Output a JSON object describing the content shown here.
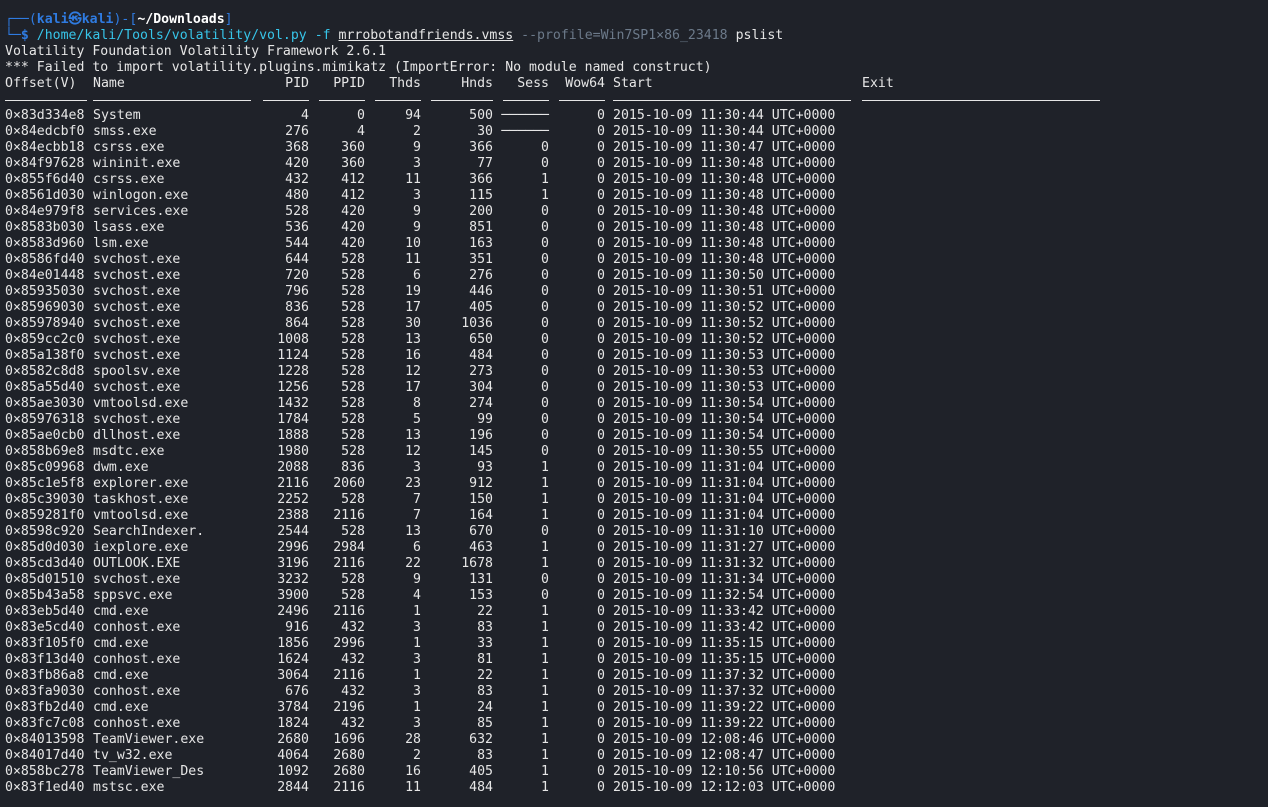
{
  "prompt": {
    "corner_top": "┌──(",
    "user": "kali",
    "at": "㉿",
    "host": "kali",
    "mid": ")-[",
    "cwd": "~/Downloads",
    "end": "]",
    "corner_bottom": "└─",
    "dollar": "$",
    "cmd_path": "/home/kali/Tools/volatility/vol.py",
    "flag_f": "-f",
    "file": "mrrobotandfriends.vmss",
    "profile": "--profile=Win7SP1×86_23418",
    "plugin": "pslist"
  },
  "output": {
    "banner": "Volatility Foundation Volatility Framework 2.6.1",
    "error": "*** Failed to import volatility.plugins.mimikatz (ImportError: No module named construct)"
  },
  "table": {
    "headers": {
      "offset": "Offset(V)",
      "name": "Name",
      "pid": "PID",
      "ppid": "PPID",
      "thds": "Thds",
      "hnds": "Hnds",
      "sess": "Sess",
      "wow64": "Wow64",
      "start": "Start",
      "exit": "Exit"
    },
    "rows": [
      {
        "offset": "0×83d334e8",
        "name": "System",
        "pid": "4",
        "ppid": "0",
        "thds": "94",
        "hnds": "500",
        "sess": "──────",
        "wow64": "0",
        "start": "2015-10-09 11:30:44 UTC+0000"
      },
      {
        "offset": "0×84edcbf0",
        "name": "smss.exe",
        "pid": "276",
        "ppid": "4",
        "thds": "2",
        "hnds": "30",
        "sess": "──────",
        "wow64": "0",
        "start": "2015-10-09 11:30:44 UTC+0000"
      },
      {
        "offset": "0×84ecbb18",
        "name": "csrss.exe",
        "pid": "368",
        "ppid": "360",
        "thds": "9",
        "hnds": "366",
        "sess": "0",
        "wow64": "0",
        "start": "2015-10-09 11:30:47 UTC+0000"
      },
      {
        "offset": "0×84f97628",
        "name": "wininit.exe",
        "pid": "420",
        "ppid": "360",
        "thds": "3",
        "hnds": "77",
        "sess": "0",
        "wow64": "0",
        "start": "2015-10-09 11:30:48 UTC+0000"
      },
      {
        "offset": "0×855f6d40",
        "name": "csrss.exe",
        "pid": "432",
        "ppid": "412",
        "thds": "11",
        "hnds": "366",
        "sess": "1",
        "wow64": "0",
        "start": "2015-10-09 11:30:48 UTC+0000"
      },
      {
        "offset": "0×8561d030",
        "name": "winlogon.exe",
        "pid": "480",
        "ppid": "412",
        "thds": "3",
        "hnds": "115",
        "sess": "1",
        "wow64": "0",
        "start": "2015-10-09 11:30:48 UTC+0000"
      },
      {
        "offset": "0×84e979f8",
        "name": "services.exe",
        "pid": "528",
        "ppid": "420",
        "thds": "9",
        "hnds": "200",
        "sess": "0",
        "wow64": "0",
        "start": "2015-10-09 11:30:48 UTC+0000"
      },
      {
        "offset": "0×8583b030",
        "name": "lsass.exe",
        "pid": "536",
        "ppid": "420",
        "thds": "9",
        "hnds": "851",
        "sess": "0",
        "wow64": "0",
        "start": "2015-10-09 11:30:48 UTC+0000"
      },
      {
        "offset": "0×8583d960",
        "name": "lsm.exe",
        "pid": "544",
        "ppid": "420",
        "thds": "10",
        "hnds": "163",
        "sess": "0",
        "wow64": "0",
        "start": "2015-10-09 11:30:48 UTC+0000"
      },
      {
        "offset": "0×8586fd40",
        "name": "svchost.exe",
        "pid": "644",
        "ppid": "528",
        "thds": "11",
        "hnds": "351",
        "sess": "0",
        "wow64": "0",
        "start": "2015-10-09 11:30:48 UTC+0000"
      },
      {
        "offset": "0×84e01448",
        "name": "svchost.exe",
        "pid": "720",
        "ppid": "528",
        "thds": "6",
        "hnds": "276",
        "sess": "0",
        "wow64": "0",
        "start": "2015-10-09 11:30:50 UTC+0000"
      },
      {
        "offset": "0×85935030",
        "name": "svchost.exe",
        "pid": "796",
        "ppid": "528",
        "thds": "19",
        "hnds": "446",
        "sess": "0",
        "wow64": "0",
        "start": "2015-10-09 11:30:51 UTC+0000"
      },
      {
        "offset": "0×85969030",
        "name": "svchost.exe",
        "pid": "836",
        "ppid": "528",
        "thds": "17",
        "hnds": "405",
        "sess": "0",
        "wow64": "0",
        "start": "2015-10-09 11:30:52 UTC+0000"
      },
      {
        "offset": "0×85978940",
        "name": "svchost.exe",
        "pid": "864",
        "ppid": "528",
        "thds": "30",
        "hnds": "1036",
        "sess": "0",
        "wow64": "0",
        "start": "2015-10-09 11:30:52 UTC+0000"
      },
      {
        "offset": "0×859cc2c0",
        "name": "svchost.exe",
        "pid": "1008",
        "ppid": "528",
        "thds": "13",
        "hnds": "650",
        "sess": "0",
        "wow64": "0",
        "start": "2015-10-09 11:30:52 UTC+0000"
      },
      {
        "offset": "0×85a138f0",
        "name": "svchost.exe",
        "pid": "1124",
        "ppid": "528",
        "thds": "16",
        "hnds": "484",
        "sess": "0",
        "wow64": "0",
        "start": "2015-10-09 11:30:53 UTC+0000"
      },
      {
        "offset": "0×8582c8d8",
        "name": "spoolsv.exe",
        "pid": "1228",
        "ppid": "528",
        "thds": "12",
        "hnds": "273",
        "sess": "0",
        "wow64": "0",
        "start": "2015-10-09 11:30:53 UTC+0000"
      },
      {
        "offset": "0×85a55d40",
        "name": "svchost.exe",
        "pid": "1256",
        "ppid": "528",
        "thds": "17",
        "hnds": "304",
        "sess": "0",
        "wow64": "0",
        "start": "2015-10-09 11:30:53 UTC+0000"
      },
      {
        "offset": "0×85ae3030",
        "name": "vmtoolsd.exe",
        "pid": "1432",
        "ppid": "528",
        "thds": "8",
        "hnds": "274",
        "sess": "0",
        "wow64": "0",
        "start": "2015-10-09 11:30:54 UTC+0000"
      },
      {
        "offset": "0×85976318",
        "name": "svchost.exe",
        "pid": "1784",
        "ppid": "528",
        "thds": "5",
        "hnds": "99",
        "sess": "0",
        "wow64": "0",
        "start": "2015-10-09 11:30:54 UTC+0000"
      },
      {
        "offset": "0×85ae0cb0",
        "name": "dllhost.exe",
        "pid": "1888",
        "ppid": "528",
        "thds": "13",
        "hnds": "196",
        "sess": "0",
        "wow64": "0",
        "start": "2015-10-09 11:30:54 UTC+0000"
      },
      {
        "offset": "0×858b69e8",
        "name": "msdtc.exe",
        "pid": "1980",
        "ppid": "528",
        "thds": "12",
        "hnds": "145",
        "sess": "0",
        "wow64": "0",
        "start": "2015-10-09 11:30:55 UTC+0000"
      },
      {
        "offset": "0×85c09968",
        "name": "dwm.exe",
        "pid": "2088",
        "ppid": "836",
        "thds": "3",
        "hnds": "93",
        "sess": "1",
        "wow64": "0",
        "start": "2015-10-09 11:31:04 UTC+0000"
      },
      {
        "offset": "0×85c1e5f8",
        "name": "explorer.exe",
        "pid": "2116",
        "ppid": "2060",
        "thds": "23",
        "hnds": "912",
        "sess": "1",
        "wow64": "0",
        "start": "2015-10-09 11:31:04 UTC+0000"
      },
      {
        "offset": "0×85c39030",
        "name": "taskhost.exe",
        "pid": "2252",
        "ppid": "528",
        "thds": "7",
        "hnds": "150",
        "sess": "1",
        "wow64": "0",
        "start": "2015-10-09 11:31:04 UTC+0000"
      },
      {
        "offset": "0×859281f0",
        "name": "vmtoolsd.exe",
        "pid": "2388",
        "ppid": "2116",
        "thds": "7",
        "hnds": "164",
        "sess": "1",
        "wow64": "0",
        "start": "2015-10-09 11:31:04 UTC+0000"
      },
      {
        "offset": "0×8598c920",
        "name": "SearchIndexer.",
        "pid": "2544",
        "ppid": "528",
        "thds": "13",
        "hnds": "670",
        "sess": "0",
        "wow64": "0",
        "start": "2015-10-09 11:31:10 UTC+0000"
      },
      {
        "offset": "0×85d0d030",
        "name": "iexplore.exe",
        "pid": "2996",
        "ppid": "2984",
        "thds": "6",
        "hnds": "463",
        "sess": "1",
        "wow64": "0",
        "start": "2015-10-09 11:31:27 UTC+0000"
      },
      {
        "offset": "0×85cd3d40",
        "name": "OUTLOOK.EXE",
        "pid": "3196",
        "ppid": "2116",
        "thds": "22",
        "hnds": "1678",
        "sess": "1",
        "wow64": "0",
        "start": "2015-10-09 11:31:32 UTC+0000"
      },
      {
        "offset": "0×85d01510",
        "name": "svchost.exe",
        "pid": "3232",
        "ppid": "528",
        "thds": "9",
        "hnds": "131",
        "sess": "0",
        "wow64": "0",
        "start": "2015-10-09 11:31:34 UTC+0000"
      },
      {
        "offset": "0×85b43a58",
        "name": "sppsvc.exe",
        "pid": "3900",
        "ppid": "528",
        "thds": "4",
        "hnds": "153",
        "sess": "0",
        "wow64": "0",
        "start": "2015-10-09 11:32:54 UTC+0000"
      },
      {
        "offset": "0×83eb5d40",
        "name": "cmd.exe",
        "pid": "2496",
        "ppid": "2116",
        "thds": "1",
        "hnds": "22",
        "sess": "1",
        "wow64": "0",
        "start": "2015-10-09 11:33:42 UTC+0000"
      },
      {
        "offset": "0×83e5cd40",
        "name": "conhost.exe",
        "pid": "916",
        "ppid": "432",
        "thds": "3",
        "hnds": "83",
        "sess": "1",
        "wow64": "0",
        "start": "2015-10-09 11:33:42 UTC+0000"
      },
      {
        "offset": "0×83f105f0",
        "name": "cmd.exe",
        "pid": "1856",
        "ppid": "2996",
        "thds": "1",
        "hnds": "33",
        "sess": "1",
        "wow64": "0",
        "start": "2015-10-09 11:35:15 UTC+0000"
      },
      {
        "offset": "0×83f13d40",
        "name": "conhost.exe",
        "pid": "1624",
        "ppid": "432",
        "thds": "3",
        "hnds": "81",
        "sess": "1",
        "wow64": "0",
        "start": "2015-10-09 11:35:15 UTC+0000"
      },
      {
        "offset": "0×83fb86a8",
        "name": "cmd.exe",
        "pid": "3064",
        "ppid": "2116",
        "thds": "1",
        "hnds": "22",
        "sess": "1",
        "wow64": "0",
        "start": "2015-10-09 11:37:32 UTC+0000"
      },
      {
        "offset": "0×83fa9030",
        "name": "conhost.exe",
        "pid": "676",
        "ppid": "432",
        "thds": "3",
        "hnds": "83",
        "sess": "1",
        "wow64": "0",
        "start": "2015-10-09 11:37:32 UTC+0000"
      },
      {
        "offset": "0×83fb2d40",
        "name": "cmd.exe",
        "pid": "3784",
        "ppid": "2196",
        "thds": "1",
        "hnds": "24",
        "sess": "1",
        "wow64": "0",
        "start": "2015-10-09 11:39:22 UTC+0000"
      },
      {
        "offset": "0×83fc7c08",
        "name": "conhost.exe",
        "pid": "1824",
        "ppid": "432",
        "thds": "3",
        "hnds": "85",
        "sess": "1",
        "wow64": "0",
        "start": "2015-10-09 11:39:22 UTC+0000"
      },
      {
        "offset": "0×84013598",
        "name": "TeamViewer.exe",
        "pid": "2680",
        "ppid": "1696",
        "thds": "28",
        "hnds": "632",
        "sess": "1",
        "wow64": "0",
        "start": "2015-10-09 12:08:46 UTC+0000"
      },
      {
        "offset": "0×84017d40",
        "name": "tv_w32.exe",
        "pid": "4064",
        "ppid": "2680",
        "thds": "2",
        "hnds": "83",
        "sess": "1",
        "wow64": "0",
        "start": "2015-10-09 12:08:47 UTC+0000"
      },
      {
        "offset": "0×858bc278",
        "name": "TeamViewer_Des",
        "pid": "1092",
        "ppid": "2680",
        "thds": "16",
        "hnds": "405",
        "sess": "1",
        "wow64": "0",
        "start": "2015-10-09 12:10:56 UTC+0000"
      },
      {
        "offset": "0×83f1ed40",
        "name": "mstsc.exe",
        "pid": "2844",
        "ppid": "2116",
        "thds": "11",
        "hnds": "484",
        "sess": "1",
        "wow64": "0",
        "start": "2015-10-09 12:12:03 UTC+0000"
      }
    ]
  }
}
